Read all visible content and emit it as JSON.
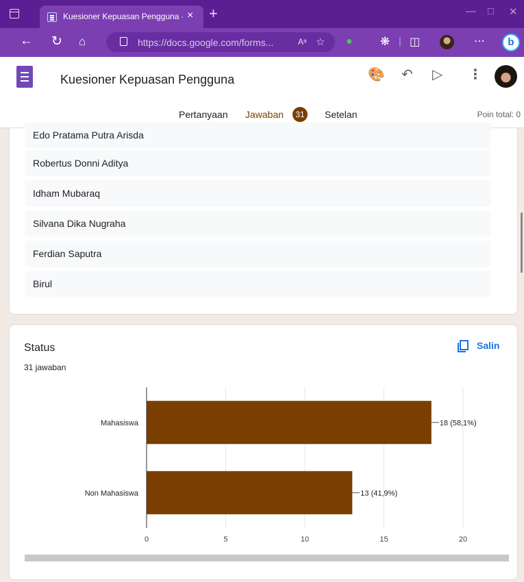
{
  "browser": {
    "tab_title": "Kuesioner Kepuasan Pengguna - Google Formulir",
    "url_host": "https://docs.google.com",
    "url_path": "/forms...",
    "read_aloud_icon": "Aᵃ",
    "new_tab": "+",
    "close_tab": "×"
  },
  "form": {
    "title": "Kuesioner Kepuasan Pengguna",
    "tabs": {
      "questions": "Pertanyaan",
      "responses": "Jawaban",
      "responses_count": "31",
      "settings": "Setelan"
    },
    "points": "Poin total: 0"
  },
  "name_list": [
    "Edo Pratama Putra Arisda",
    "Robertus Donni Aditya",
    "Idham Mubaraq",
    "Silvana Dika Nugraha",
    "Ferdian Saputra",
    "Birul"
  ],
  "status_question": {
    "title": "Status",
    "response_count": "31 jawaban",
    "copy_label": "Salin"
  },
  "chart_data": {
    "type": "bar",
    "orientation": "horizontal",
    "categories": [
      "Mahasiswa",
      "Non Mahasiswa"
    ],
    "values": [
      18,
      13
    ],
    "data_labels": [
      "18 (58,1%)",
      "13 (41,9%)"
    ],
    "xlim": [
      0,
      20
    ],
    "xticks": [
      0,
      5,
      10,
      15,
      20
    ],
    "bar_color": "#7a3e00",
    "grid": true
  },
  "colors": {
    "accent": "#7a3e00",
    "browser_frame": "#7b3fb2",
    "link_blue": "#1a73e8"
  }
}
